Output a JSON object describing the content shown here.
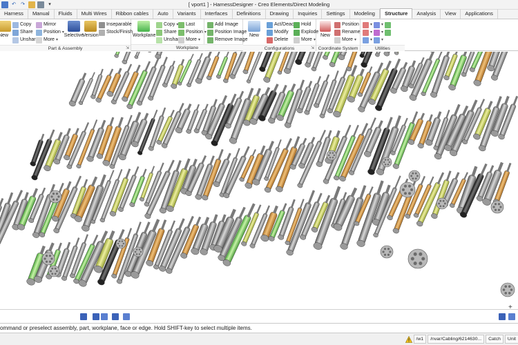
{
  "window": {
    "title": "[ vport1 ] - HarnessDesigner - Creo Elements/Direct Modeling"
  },
  "quick_access": [
    "save-icon",
    "undo-icon",
    "redo-icon",
    "open-icon",
    "print-icon",
    "customize-icon"
  ],
  "tabs": [
    {
      "label": "Harness",
      "active": false
    },
    {
      "label": "Manual",
      "active": false
    },
    {
      "label": "Fluids",
      "active": false
    },
    {
      "label": "Multi Wires",
      "active": false
    },
    {
      "label": "Ribbon cables",
      "active": false
    },
    {
      "label": "Auto",
      "active": false
    },
    {
      "label": "Variants",
      "active": false
    },
    {
      "label": "Interfaces",
      "active": false
    },
    {
      "label": "Definitions",
      "active": false
    },
    {
      "label": "Drawing",
      "active": false
    },
    {
      "label": "Inquiries",
      "active": false
    },
    {
      "label": "Settings",
      "active": false
    },
    {
      "label": "Modeling",
      "active": false
    },
    {
      "label": "Structure",
      "active": true
    },
    {
      "label": "Analysis",
      "active": false
    },
    {
      "label": "View",
      "active": false
    },
    {
      "label": "Applications",
      "active": false
    }
  ],
  "ribbon": {
    "part_assembly": {
      "label": "Part & Assembly",
      "new_label": "New",
      "assembly_label": "ssembly",
      "copy": "Copy",
      "share": "Share",
      "unshare": "Unshare",
      "mirror": "Mirror",
      "position": "Position",
      "more": "More",
      "selective": "Selective",
      "version": "Version",
      "inseparable": "Inseparable",
      "stock_finish": "Stock/Finish"
    },
    "workplane": {
      "label": "Workplane",
      "workplane_btn": "Workplane",
      "copy": "Copy",
      "share": "Share",
      "unshare": "Unshare",
      "last": "Last",
      "position": "Position",
      "more": "More",
      "add_image": "Add Image",
      "position_image": "Position Image",
      "remove_image": "Remove Image"
    },
    "configurations": {
      "label": "Configurations",
      "new": "New",
      "act_deact": "Act/Deact",
      "modify": "Modify",
      "delete": "Delete",
      "hold": "Hold",
      "explode": "Explode",
      "more": "More"
    },
    "coordinate_system": {
      "label": "Coordinate System",
      "new": "New",
      "position": "Position",
      "rename": "Rename",
      "more": "More"
    },
    "utilities": {
      "label": "Utilities"
    }
  },
  "prompt": {
    "text": "ommand or preselect assembly, part, workplane, face or edge. Hold SHIFT-key to select multiple items."
  },
  "statusbar": {
    "path": "/w1",
    "part": "/nvar/Cabling/6214630...",
    "catch": "Catch",
    "units": "Unit"
  },
  "colors": {
    "orange": "#d99a3e",
    "green": "#7fd75a",
    "yellow_green": "#c8d85a",
    "gray": "#8e8e8e",
    "dark": "#2e2e2e",
    "accent": "#1e57b0"
  }
}
